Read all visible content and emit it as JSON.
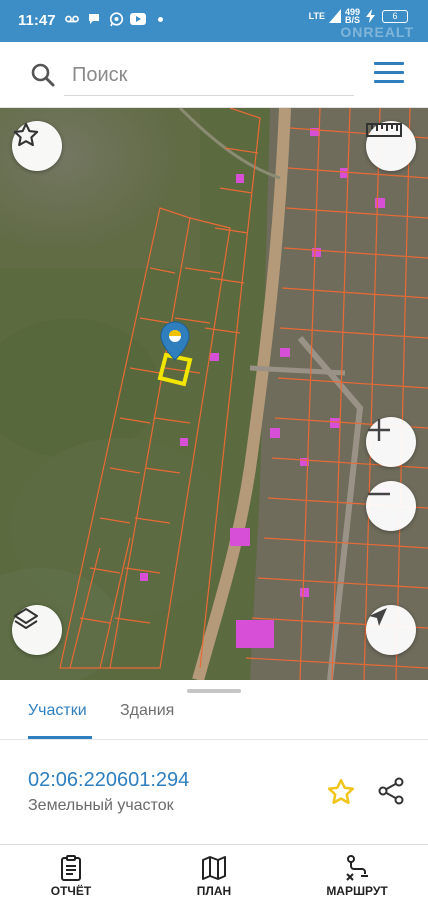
{
  "status_bar": {
    "time": "11:47",
    "network_type": "LTE",
    "network_speed_value": "499",
    "network_speed_unit": "B/S",
    "battery": "6",
    "watermark": "ONREALT"
  },
  "search": {
    "placeholder": "Поиск"
  },
  "tabs": [
    {
      "label": "Участки",
      "active": true
    },
    {
      "label": "Здания",
      "active": false
    }
  ],
  "parcel": {
    "cadastral_number": "02:06:220601:294",
    "type": "Земельный участок"
  },
  "bottom_nav": [
    {
      "label": "ОТЧЁТ",
      "icon": "report-icon"
    },
    {
      "label": "ПЛАН",
      "icon": "map-icon"
    },
    {
      "label": "МАРШРУТ",
      "icon": "route-icon"
    }
  ],
  "colors": {
    "accent": "#2f7fbf",
    "status_bar": "#3d8ec7",
    "parcel_outline": "#e86a35",
    "selected_parcel": "#f2e600",
    "building_highlight": "#d64fd6",
    "star_favorite": "#f0c419"
  },
  "icons": {
    "map_controls": [
      "star-icon",
      "ruler-icon",
      "zoom-in-icon",
      "zoom-out-icon",
      "layers-icon",
      "locate-icon"
    ],
    "map_marker": "location-pin-icon"
  }
}
